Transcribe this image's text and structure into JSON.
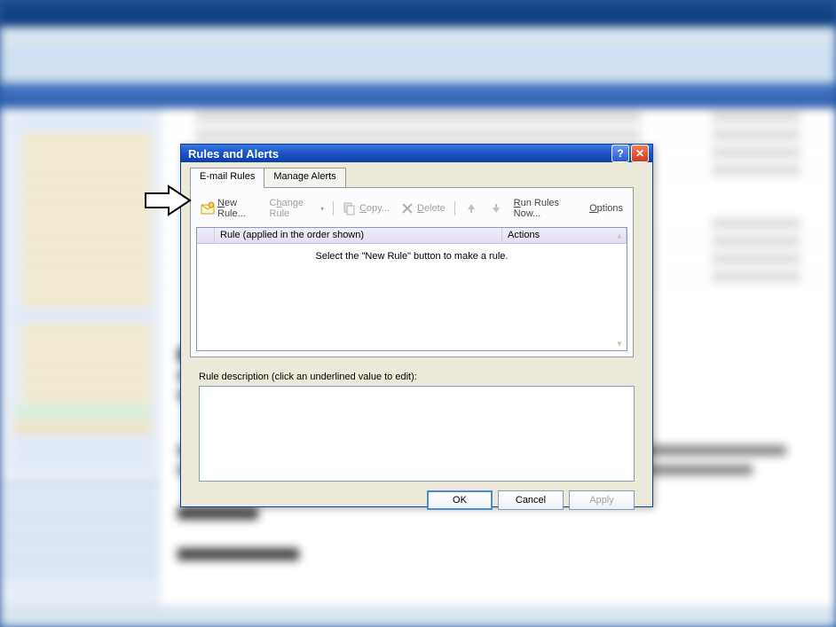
{
  "dialog": {
    "title": "Rules and Alerts",
    "tabs": [
      {
        "label": "E-mail Rules",
        "active": true
      },
      {
        "label": "Manage Alerts",
        "active": false
      }
    ],
    "toolbar": {
      "new_rule": "New Rule...",
      "change_rule": "Change Rule",
      "copy": "Copy...",
      "delete": "Delete",
      "run_rules": "Run Rules Now...",
      "options": "Options"
    },
    "rule_list": {
      "header_rule": "Rule (applied in the order shown)",
      "header_actions": "Actions",
      "empty_text": "Select the \"New Rule\" button to make a rule.",
      "rules": []
    },
    "description_label": "Rule description (click an underlined value to edit):",
    "buttons": {
      "ok": "OK",
      "cancel": "Cancel",
      "apply": "Apply"
    }
  }
}
